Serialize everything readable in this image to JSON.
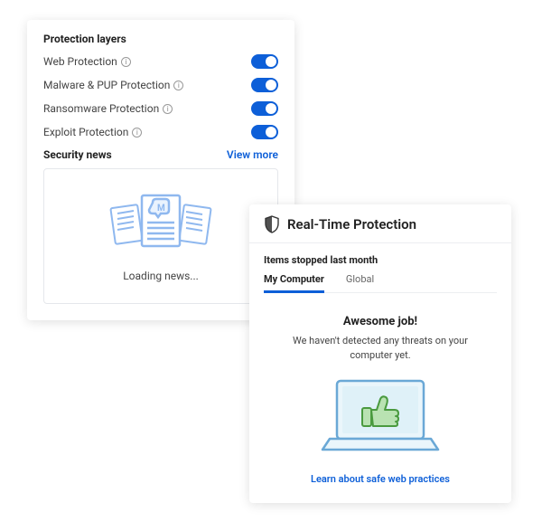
{
  "protection_layers": {
    "title": "Protection layers",
    "items": [
      {
        "label": "Web Protection",
        "enabled": true
      },
      {
        "label": "Malware & PUP Protection",
        "enabled": true
      },
      {
        "label": "Ransomware Protection",
        "enabled": true
      },
      {
        "label": "Exploit Protection",
        "enabled": true
      }
    ]
  },
  "security_news": {
    "title": "Security news",
    "view_more": "View more",
    "loading": "Loading news..."
  },
  "realtime": {
    "title": "Real-Time Protection",
    "subtitle": "Items stopped last month",
    "tabs": [
      {
        "label": "My Computer",
        "active": true
      },
      {
        "label": "Global",
        "active": false
      }
    ],
    "headline": "Awesome job!",
    "message": "We haven't detected any threats on your computer yet.",
    "learn_link": "Learn about safe web practices"
  },
  "colors": {
    "accent": "#0d5fd8",
    "illustration_stroke": "#8fb8ef",
    "thumb_stroke": "#4a9a3f",
    "thumb_fill": "#b9e2b2"
  }
}
